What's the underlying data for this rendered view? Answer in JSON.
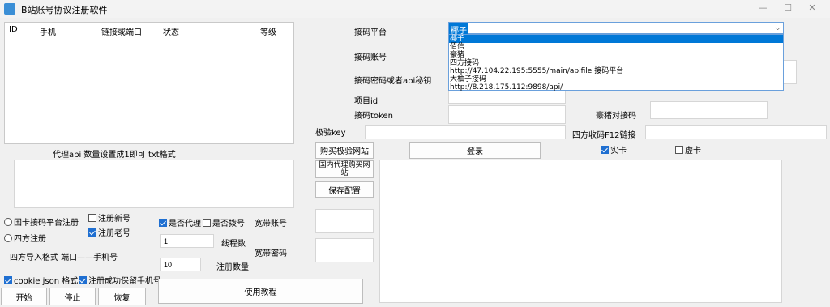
{
  "window": {
    "title": "B站账号协议注册软件",
    "minimize": "—",
    "maximize": "☐",
    "close": "✕"
  },
  "table": {
    "columns": [
      "ID",
      "手机",
      "链接或端口",
      "状态",
      "等级"
    ]
  },
  "proxy": {
    "label": "代理api  数量设置成1即可  txt格式"
  },
  "options": {
    "radio_guoka": "国卡接码平台注册",
    "radio_sifang": "四方注册",
    "cb_new": "注册新号",
    "cb_old": "注册老号",
    "cb_proxy": "是否代理",
    "cb_dial": "是否拨号",
    "sifang_format": "四方导入格式  端口——手机号",
    "cb_cookie": "cookie json 格式",
    "cb_keep": "注册成功保留手机号"
  },
  "threads": {
    "label": "线程数",
    "value": "1"
  },
  "count": {
    "label": "注册数量",
    "value": "10"
  },
  "broadband": {
    "account": "宽带账号",
    "password": "宽带密码"
  },
  "buttons": {
    "start": "开始",
    "stop": "停止",
    "resume": "恢复",
    "tutorial": "使用教程",
    "buy_jiyan": "购买极验网站",
    "buy_proxy": "国内代理购买网站",
    "save": "保存配置",
    "login": "登录"
  },
  "form": {
    "platform_label": "接码平台",
    "account_label": "接码账号",
    "pass_label": "接码密码或者api秘钥",
    "project_label": "项目id",
    "token_label": "接码token",
    "jiyan_label": "极验key",
    "haozhu_label": "豪猪对接码",
    "sifang_f12_label": "四方收码F12链接",
    "real_card": "实卡",
    "virtual_card": "虚卡"
  },
  "dropdown": {
    "selected": "椰子",
    "items": [
      "椰子",
      "佰信",
      "豪猪",
      "四方接码",
      "http://47.104.22.195:5555/main/apifile 接码平台",
      "大柚子接码",
      "http://8.218.175.112:9898/api/"
    ]
  }
}
